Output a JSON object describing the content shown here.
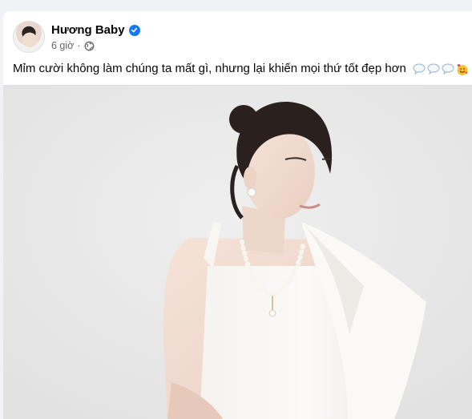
{
  "post": {
    "author_name": "Hương Baby",
    "time": "6 giờ",
    "separator": "·",
    "caption": "Mỉm cười không làm chúng ta mất gì, nhưng lại khiến mọi thứ tốt đẹp hơn",
    "verified_color": "#1877f2",
    "emojis": [
      "speech-bubble-icon",
      "speech-bubble-icon",
      "speech-bubble-icon",
      "smiling-face-with-hearts-icon"
    ]
  }
}
